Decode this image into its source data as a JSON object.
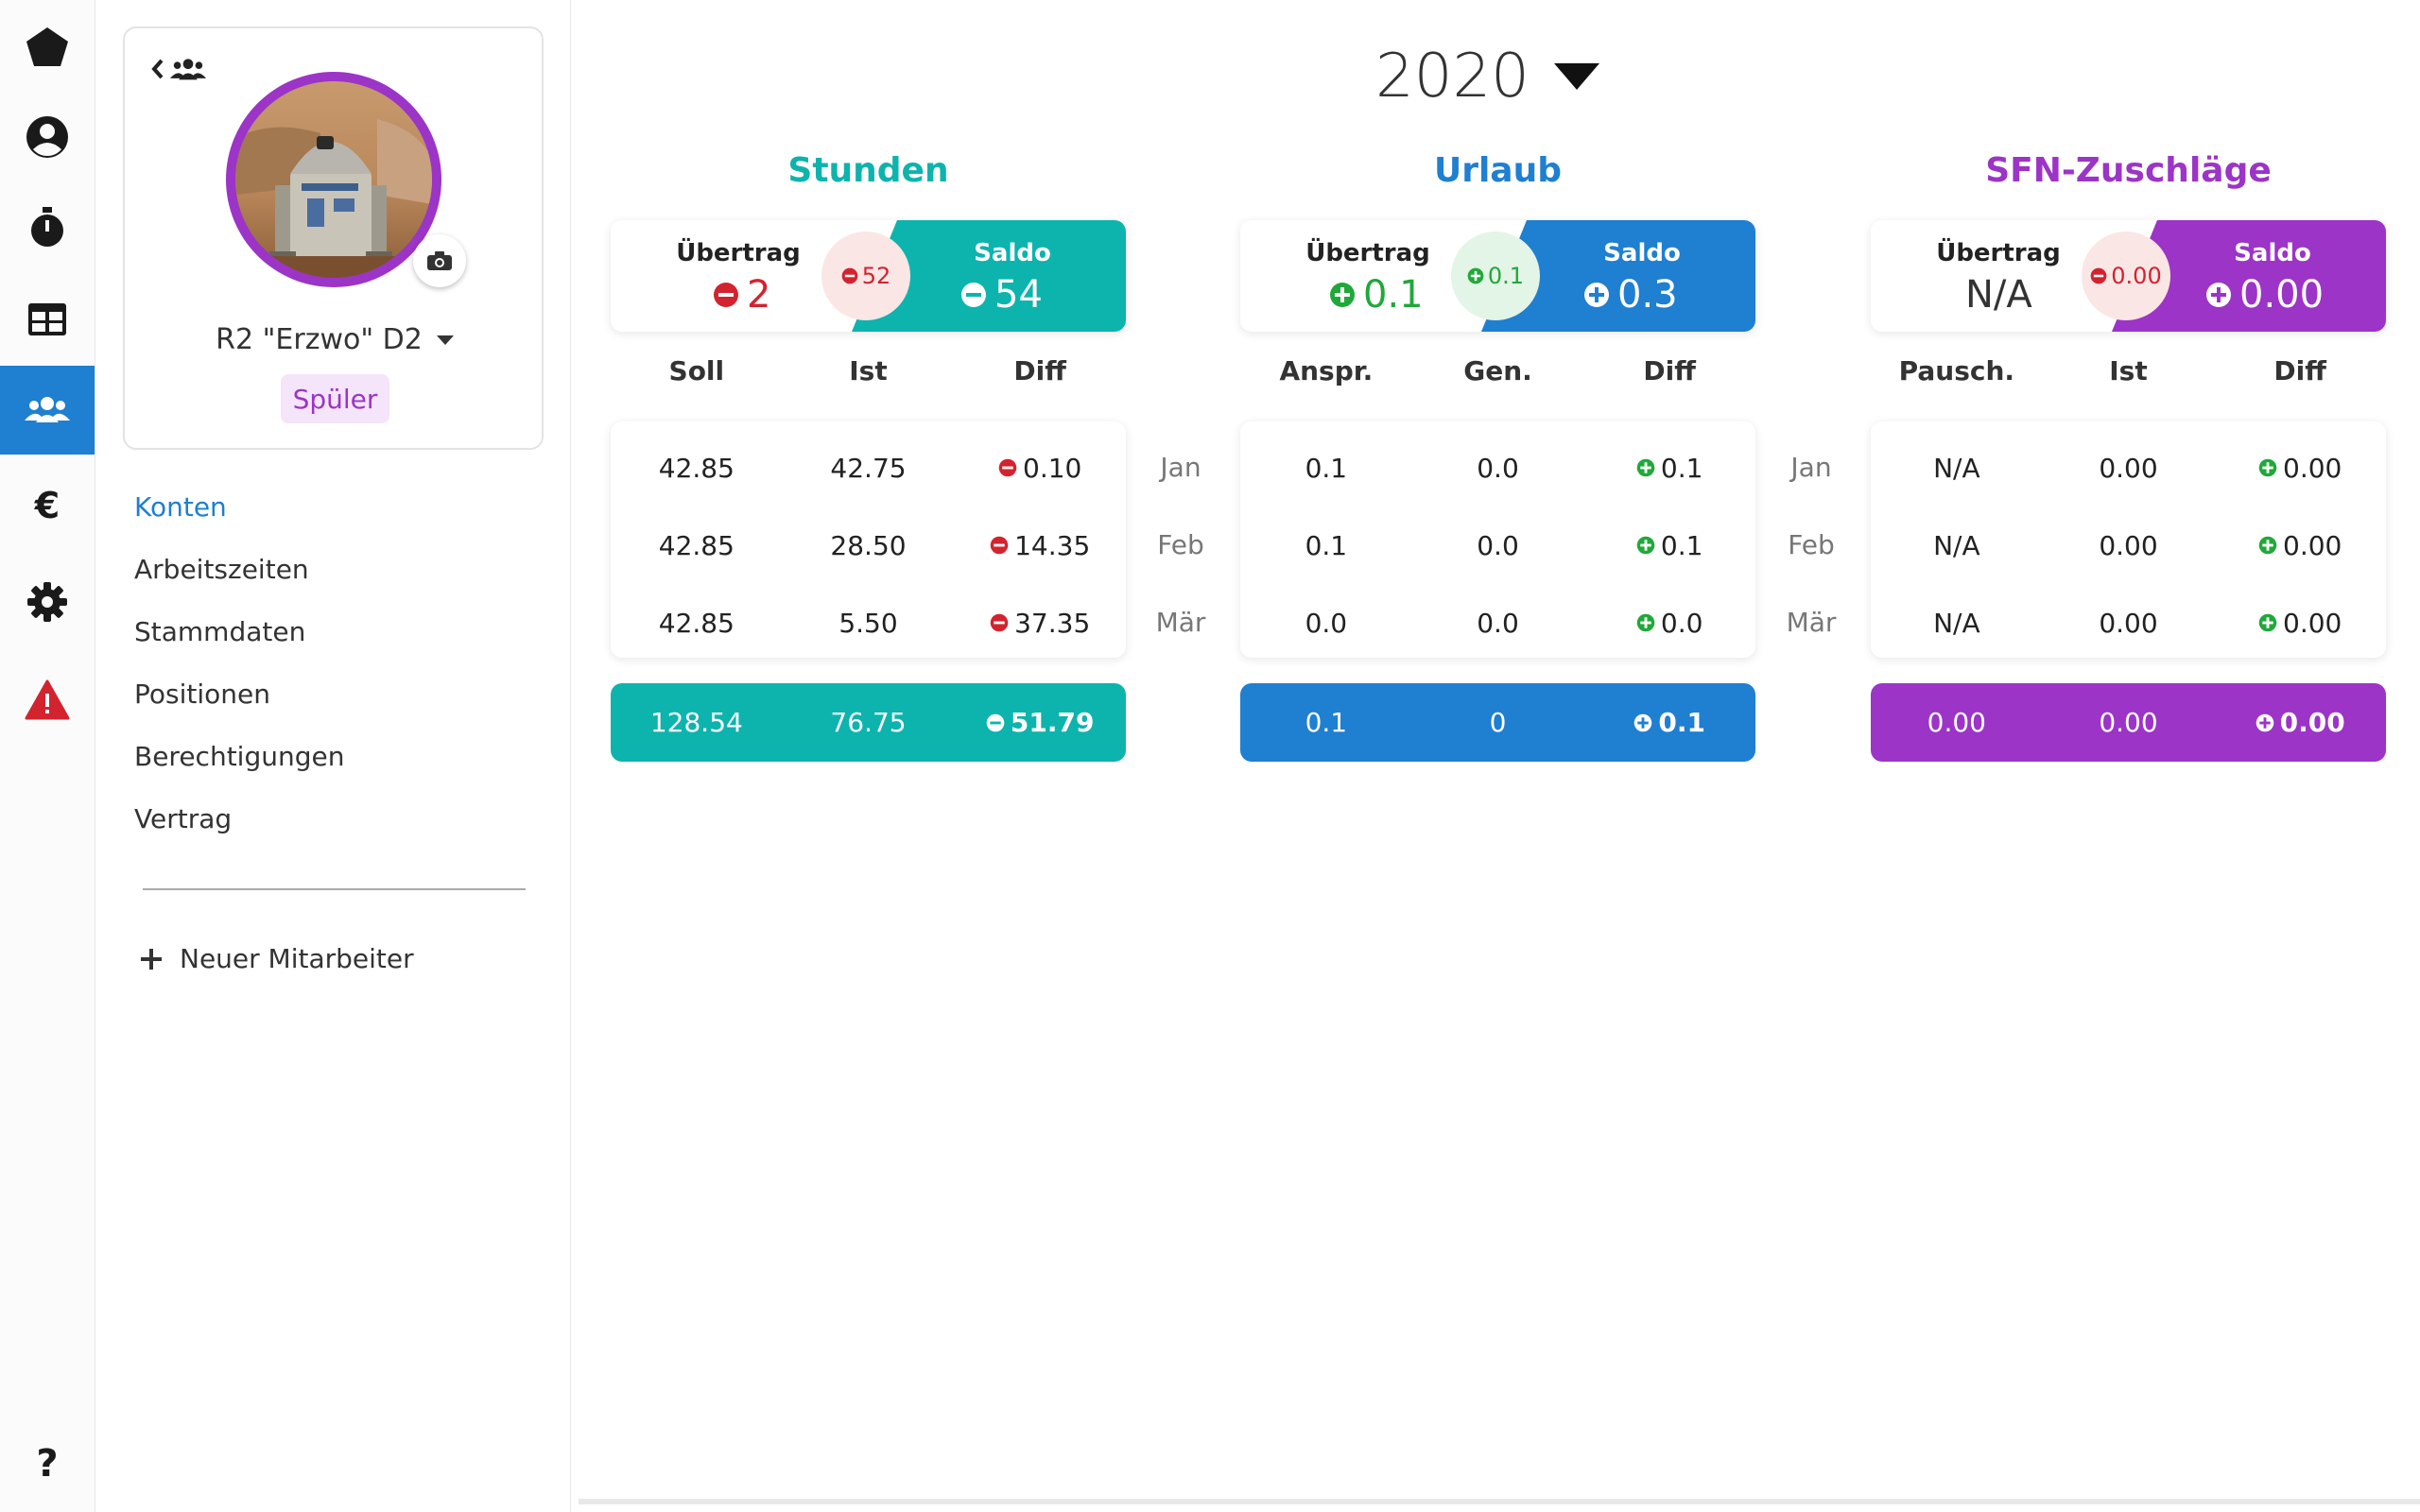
{
  "colors": {
    "primary": "#1f7fd1",
    "teal": "#0db4ad",
    "purple": "#9c34c7",
    "red": "#d3232f",
    "green": "#20a83a"
  },
  "rail": {
    "items": [
      {
        "icon": "pentagon-logo-icon"
      },
      {
        "icon": "user-circle-icon"
      },
      {
        "icon": "stopwatch-icon"
      },
      {
        "icon": "table-icon"
      },
      {
        "icon": "users-icon",
        "active": true
      },
      {
        "icon": "euro-icon"
      },
      {
        "icon": "gear-icon"
      },
      {
        "icon": "warning-icon"
      },
      {
        "icon": "question-icon"
      }
    ]
  },
  "profile": {
    "name": "R2 \"Erzwo\" D2",
    "role": "Spüler"
  },
  "nav": {
    "items": [
      "Konten",
      "Arbeitszeiten",
      "Stammdaten",
      "Positionen",
      "Berechtigungen",
      "Vertrag"
    ],
    "active_index": 0,
    "new_employee": "Neuer Mitarbeiter"
  },
  "year": "2020",
  "months": [
    "Jan",
    "Feb",
    "Mär"
  ],
  "stunden": {
    "title": "Stunden",
    "uebertrag_label": "Übertrag",
    "uebertrag_value": "2",
    "bubble": "52",
    "saldo_label": "Saldo",
    "saldo_value": "54",
    "headers": [
      "Soll",
      "Ist",
      "Diff"
    ],
    "rows": [
      [
        "42.85",
        "42.75",
        "0.10"
      ],
      [
        "42.85",
        "28.50",
        "14.35"
      ],
      [
        "42.85",
        "5.50",
        "37.35"
      ]
    ],
    "totals": [
      "128.54",
      "76.75",
      "51.79"
    ]
  },
  "urlaub": {
    "title": "Urlaub",
    "uebertrag_label": "Übertrag",
    "uebertrag_value": "0.1",
    "bubble": "0.1",
    "saldo_label": "Saldo",
    "saldo_value": "0.3",
    "headers": [
      "Anspr.",
      "Gen.",
      "Diff"
    ],
    "rows": [
      [
        "0.1",
        "0.0",
        "0.1"
      ],
      [
        "0.1",
        "0.0",
        "0.1"
      ],
      [
        "0.0",
        "0.0",
        "0.0"
      ]
    ],
    "totals": [
      "0.1",
      "0",
      "0.1"
    ]
  },
  "sfn": {
    "title": "SFN-Zuschläge",
    "uebertrag_label": "Übertrag",
    "uebertrag_value": "N/A",
    "bubble": "0.00",
    "saldo_label": "Saldo",
    "saldo_value": "0.00",
    "headers": [
      "Pausch.",
      "Ist",
      "Diff"
    ],
    "rows": [
      [
        "N/A",
        "0.00",
        "0.00"
      ],
      [
        "N/A",
        "0.00",
        "0.00"
      ],
      [
        "N/A",
        "0.00",
        "0.00"
      ]
    ],
    "totals": [
      "0.00",
      "0.00",
      "0.00"
    ]
  }
}
